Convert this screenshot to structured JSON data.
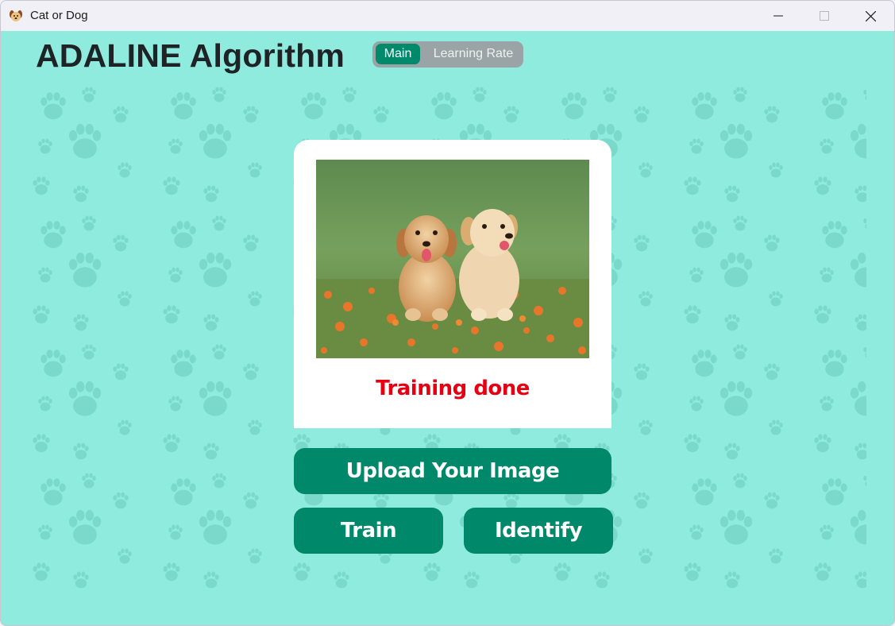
{
  "window": {
    "title": "Cat or Dog",
    "icon": "dog-face-icon",
    "controls": [
      "minimize-icon",
      "maximize-icon",
      "close-icon"
    ]
  },
  "header": {
    "title": "ADALINE Algorithm"
  },
  "tabs": [
    {
      "label": "Main",
      "selected": true
    },
    {
      "label": "Learning Rate",
      "selected": false
    }
  ],
  "preview": {
    "image": "two golden retriever puppies sitting in grass with orange flowers",
    "status": "Training done"
  },
  "buttons": {
    "upload": "Upload Your Image",
    "train": "Train",
    "identify": "Identify"
  },
  "colors": {
    "background": "#90ebdf",
    "accent": "#00886a",
    "status": "#e60012",
    "paw": "#6fcfc1"
  }
}
